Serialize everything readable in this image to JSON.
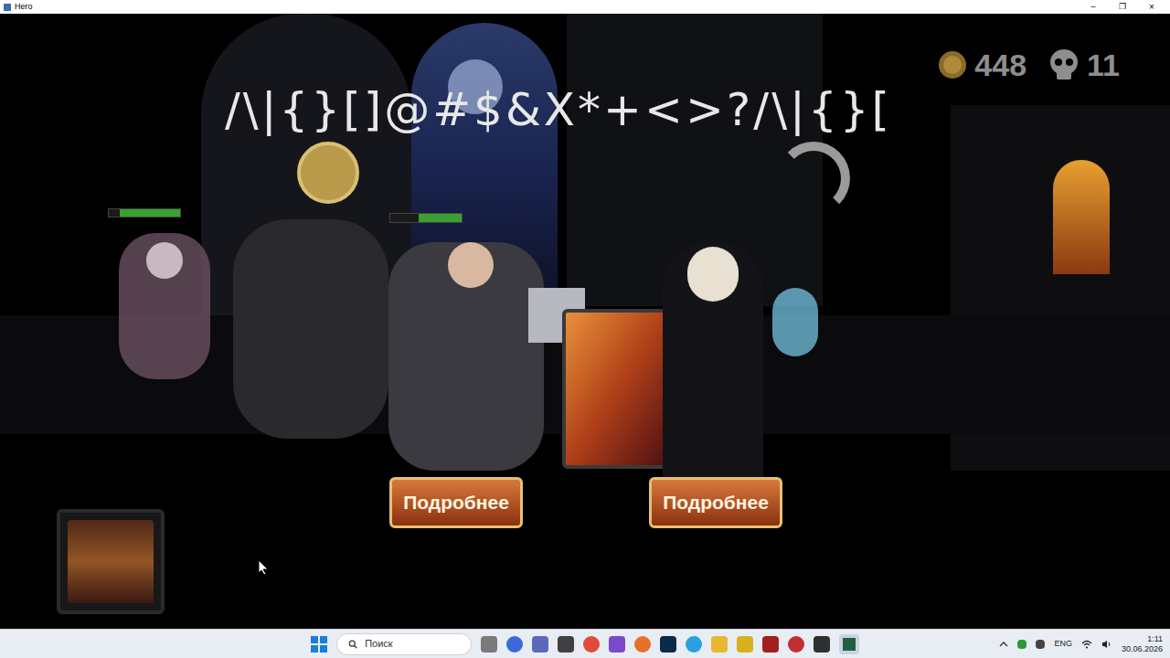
{
  "window": {
    "title": "Hero",
    "controls": [
      "–",
      "❐",
      "×"
    ]
  },
  "hud": {
    "coins": "448",
    "skulls": "11"
  },
  "banner": "/\\|{}[]@#$&X*+<>?/\\|{}[",
  "health_bars": [
    {
      "level": 0.85
    },
    {
      "level": 0.6
    }
  ],
  "buttons": [
    {
      "label": "Подробнее"
    },
    {
      "label": "Подробнее"
    }
  ],
  "taskbar": {
    "search": {
      "placeholder": "Поиск"
    },
    "language": "ENG",
    "time": "1:11",
    "date": "30.06.2026"
  }
}
